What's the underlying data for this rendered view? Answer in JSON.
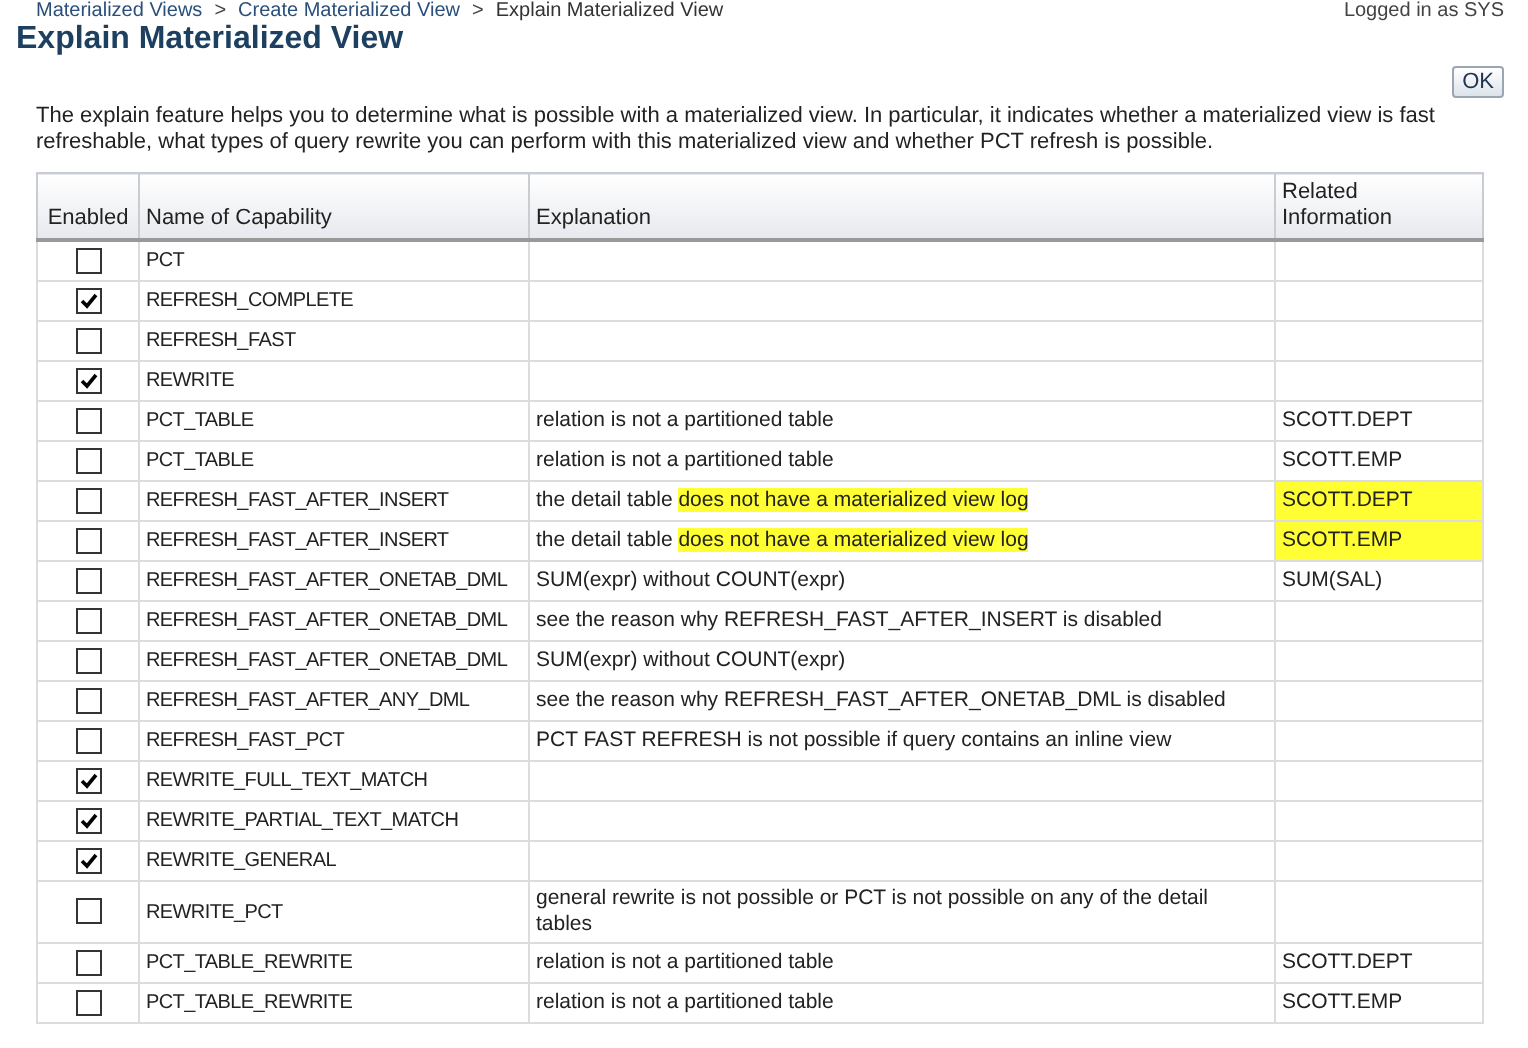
{
  "breadcrumbs": [
    {
      "label": "Materialized Views"
    },
    {
      "label": "Create Materialized View"
    },
    {
      "label": "Explain Materialized View"
    }
  ],
  "breadcrumb_separator": ">",
  "user_status": "Logged in as SYS",
  "page_title": "Explain Materialized View",
  "ok_button": "OK",
  "description": "The explain feature helps you to determine what is possible with a materialized view. In particular, it indicates whether a materialized view is fast refreshable, what types of query rewrite you can perform with this materialized view and whether PCT refresh is possible.",
  "table": {
    "columns": [
      "Enabled",
      "Name of Capability",
      "Explanation",
      "Related Information"
    ],
    "rows": [
      {
        "enabled": false,
        "capability": "PCT",
        "explanation": [],
        "related": "",
        "related_highlighted": false
      },
      {
        "enabled": true,
        "capability": "REFRESH_COMPLETE",
        "explanation": [],
        "related": "",
        "related_highlighted": false
      },
      {
        "enabled": false,
        "capability": "REFRESH_FAST",
        "explanation": [],
        "related": "",
        "related_highlighted": false
      },
      {
        "enabled": true,
        "capability": "REWRITE",
        "explanation": [],
        "related": "",
        "related_highlighted": false
      },
      {
        "enabled": false,
        "capability": "PCT_TABLE",
        "explanation": [
          {
            "text": "relation is not a partitioned table",
            "highlighted": false
          }
        ],
        "related": "SCOTT.DEPT",
        "related_highlighted": false
      },
      {
        "enabled": false,
        "capability": "PCT_TABLE",
        "explanation": [
          {
            "text": "relation is not a partitioned table",
            "highlighted": false
          }
        ],
        "related": "SCOTT.EMP",
        "related_highlighted": false
      },
      {
        "enabled": false,
        "capability": "REFRESH_FAST_AFTER_INSERT",
        "explanation": [
          {
            "text": "the detail table ",
            "highlighted": false
          },
          {
            "text": "does not have a materialized view log",
            "highlighted": true
          }
        ],
        "related": "SCOTT.DEPT",
        "related_highlighted": true
      },
      {
        "enabled": false,
        "capability": "REFRESH_FAST_AFTER_INSERT",
        "explanation": [
          {
            "text": "the detail table ",
            "highlighted": false
          },
          {
            "text": "does not have a materialized view log",
            "highlighted": true
          }
        ],
        "related": "SCOTT.EMP",
        "related_highlighted": true
      },
      {
        "enabled": false,
        "capability": "REFRESH_FAST_AFTER_ONETAB_DML",
        "explanation": [
          {
            "text": "SUM(expr) without COUNT(expr)",
            "highlighted": false
          }
        ],
        "related": "SUM(SAL)",
        "related_highlighted": false
      },
      {
        "enabled": false,
        "capability": "REFRESH_FAST_AFTER_ONETAB_DML",
        "explanation": [
          {
            "text": "see the reason why REFRESH_FAST_AFTER_INSERT is disabled",
            "highlighted": false
          }
        ],
        "related": "",
        "related_highlighted": false
      },
      {
        "enabled": false,
        "capability": "REFRESH_FAST_AFTER_ONETAB_DML",
        "explanation": [
          {
            "text": "SUM(expr) without COUNT(expr)",
            "highlighted": false
          }
        ],
        "related": "",
        "related_highlighted": false
      },
      {
        "enabled": false,
        "capability": "REFRESH_FAST_AFTER_ANY_DML",
        "explanation": [
          {
            "text": "see the reason why REFRESH_FAST_AFTER_ONETAB_DML is disabled",
            "highlighted": false
          }
        ],
        "related": "",
        "related_highlighted": false
      },
      {
        "enabled": false,
        "capability": "REFRESH_FAST_PCT",
        "explanation": [
          {
            "text": "PCT FAST REFRESH is not possible if query contains an inline view",
            "highlighted": false
          }
        ],
        "related": "",
        "related_highlighted": false
      },
      {
        "enabled": true,
        "capability": "REWRITE_FULL_TEXT_MATCH",
        "explanation": [],
        "related": "",
        "related_highlighted": false
      },
      {
        "enabled": true,
        "capability": "REWRITE_PARTIAL_TEXT_MATCH",
        "explanation": [],
        "related": "",
        "related_highlighted": false
      },
      {
        "enabled": true,
        "capability": "REWRITE_GENERAL",
        "explanation": [],
        "related": "",
        "related_highlighted": false
      },
      {
        "enabled": false,
        "capability": "REWRITE_PCT",
        "explanation": [
          {
            "text": "general rewrite is not possible or PCT is not possible on any of the detail tables",
            "highlighted": false
          }
        ],
        "related": "",
        "related_highlighted": false
      },
      {
        "enabled": false,
        "capability": "PCT_TABLE_REWRITE",
        "explanation": [
          {
            "text": "relation is not a partitioned table",
            "highlighted": false
          }
        ],
        "related": "SCOTT.DEPT",
        "related_highlighted": false
      },
      {
        "enabled": false,
        "capability": "PCT_TABLE_REWRITE",
        "explanation": [
          {
            "text": "relation is not a partitioned table",
            "highlighted": false
          }
        ],
        "related": "SCOTT.EMP",
        "related_highlighted": false
      }
    ]
  }
}
